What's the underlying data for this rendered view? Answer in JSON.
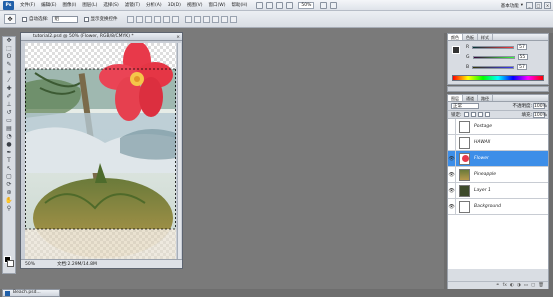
{
  "app": {
    "logo": "Ps"
  },
  "menubar": {
    "items": [
      "文件(F)",
      "编辑(E)",
      "图像(I)",
      "图层(L)",
      "选择(S)",
      "滤镜(T)",
      "分析(A)",
      "3D(D)",
      "视图(V)",
      "窗口(W)",
      "帮助(H)"
    ],
    "zoom": "50%",
    "workspace": "基本功能",
    "win_min": "_",
    "win_max": "□",
    "win_close": "×"
  },
  "options": {
    "auto_select_label": "自动选择:",
    "auto_select_value": "组",
    "show_transform_label": "显示变换控件"
  },
  "document": {
    "title": "tutorial2.psd @ 50% (Flower, RGB/8/CMYK) *",
    "close": "×",
    "zoom": "50%",
    "doc_info": "文档:2.29M/14.8M"
  },
  "color_panel": {
    "tabs": [
      "颜色",
      "色板",
      "样式"
    ],
    "rows": [
      {
        "label": "R",
        "value": "57"
      },
      {
        "label": "G",
        "value": "55"
      },
      {
        "label": "B",
        "value": "57"
      }
    ],
    "accent_color": "#393739"
  },
  "adjust_panel": {
    "tabs": [
      "调整",
      "蒙版"
    ]
  },
  "layers_panel": {
    "tabs": [
      "图层",
      "通道",
      "路径"
    ],
    "blend_mode": "正常",
    "opacity_label": "不透明度:",
    "opacity_value": "100%",
    "lock_label": "锁定:",
    "fill_label": "填充:",
    "fill_value": "100%",
    "layers": [
      {
        "name": "Postage",
        "visible": false,
        "selected": false,
        "thumb": "outline"
      },
      {
        "name": "HAWAII",
        "visible": false,
        "selected": false,
        "thumb": "outline"
      },
      {
        "name": "Flower",
        "visible": true,
        "selected": true,
        "thumb": "flower"
      },
      {
        "name": "Pineapple",
        "visible": true,
        "selected": false,
        "thumb": "pineapple"
      },
      {
        "name": "Layer 1",
        "visible": true,
        "selected": false,
        "thumb": "dark"
      },
      {
        "name": "Background",
        "visible": true,
        "selected": false,
        "thumb": "white"
      }
    ],
    "footer_icons": [
      "link-icon",
      "fx-icon",
      "mask-icon",
      "adjust-icon",
      "folder-icon",
      "new-layer-icon",
      "trash-icon"
    ]
  },
  "taskbar": {
    "item": "Beach.psd..."
  }
}
